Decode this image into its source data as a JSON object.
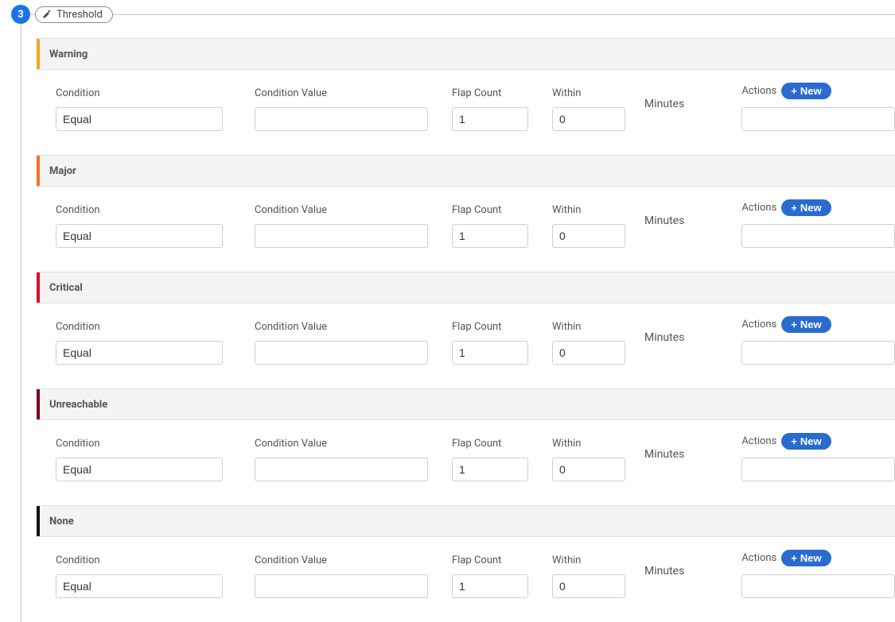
{
  "step": {
    "number": "3",
    "title": "Threshold"
  },
  "labels": {
    "condition": "Condition",
    "condition_value": "Condition Value",
    "flap_count": "Flap Count",
    "within": "Within",
    "minutes": "Minutes",
    "actions": "Actions",
    "new": "New"
  },
  "sections": [
    {
      "name": "Warning",
      "color_class": "clr-warning",
      "condition": "Equal",
      "condition_value": "",
      "flap_count": "1",
      "within": "0"
    },
    {
      "name": "Major",
      "color_class": "clr-major",
      "condition": "Equal",
      "condition_value": "",
      "flap_count": "1",
      "within": "0"
    },
    {
      "name": "Critical",
      "color_class": "clr-critical",
      "condition": "Equal",
      "condition_value": "",
      "flap_count": "1",
      "within": "0"
    },
    {
      "name": "Unreachable",
      "color_class": "clr-unreachable",
      "condition": "Equal",
      "condition_value": "",
      "flap_count": "1",
      "within": "0"
    },
    {
      "name": "None",
      "color_class": "clr-none",
      "condition": "Equal",
      "condition_value": "",
      "flap_count": "1",
      "within": "0"
    }
  ]
}
